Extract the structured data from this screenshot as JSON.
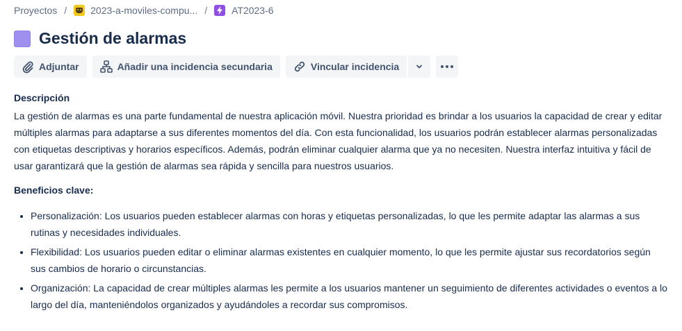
{
  "breadcrumb": {
    "projects": "Proyectos",
    "project": "2023-a-moviles-compu...",
    "issue_key": "AT2023-6",
    "separator": "/"
  },
  "issue": {
    "title": "Gestión de alarmas",
    "type_color": "#9f8fef"
  },
  "toolbar": {
    "attach": "Adjuntar",
    "add_child": "Añadir una incidencia secundaria",
    "link_issue": "Vincular incidencia"
  },
  "description": {
    "label": "Descripción",
    "text": "La gestión de alarmas es una parte fundamental de nuestra aplicación móvil. Nuestra prioridad es brindar a los usuarios la capacidad de crear y editar múltiples alarmas para adaptarse a sus diferentes momentos del día. Con esta funcionalidad, los usuarios podrán establecer alarmas personalizadas con etiquetas descriptivas y horarios específicos. Además, podrán eliminar cualquier alarma que ya no necesiten. Nuestra interfaz intuitiva y fácil de usar garantizará que la gestión de alarmas sea rápida y sencilla para nuestros usuarios.",
    "benefits_title": "Beneficios clave:",
    "benefits": [
      "Personalización: Los usuarios pueden establecer alarmas con horas y etiquetas personalizadas, lo que les permite adaptar las alarmas a sus rutinas y necesidades individuales.",
      "Flexibilidad: Los usuarios pueden editar o eliminar alarmas existentes en cualquier momento, lo que les permite ajustar sus recordatorios según sus cambios de horario o circunstancias.",
      "Organización: La capacidad de crear múltiples alarmas les permite a los usuarios mantener un seguimiento de diferentes actividades o eventos a lo largo del día, manteniéndolos organizados y ayudándoles a recordar sus compromisos."
    ]
  },
  "icons": {
    "project": "project-avatar-icon",
    "epic": "lightning-icon",
    "attach": "paperclip-icon",
    "add_child": "hierarchy-icon",
    "link": "link-icon",
    "caret": "chevron-down-icon",
    "more": "more-horizontal-icon"
  }
}
